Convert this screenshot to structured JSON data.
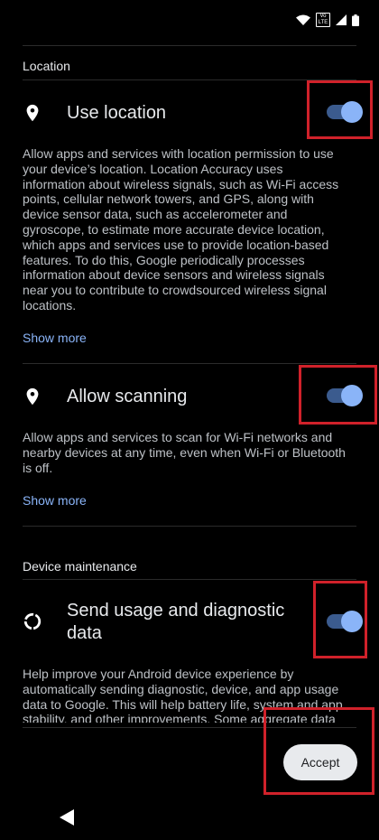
{
  "status_bar": {
    "lte_text": "Vo LTE"
  },
  "location_section": {
    "header": "Location",
    "use_location": {
      "title": "Use location",
      "enabled": true,
      "description": "Allow apps and services with location permission to use your device’s location. Location Accuracy uses information about wireless signals, such as Wi-Fi access points, cellular network towers, and GPS, along with device sensor data, such as accelerometer and gyroscope, to estimate more accurate device location, which apps and services use to provide location-based features. To do this, Google periodically processes information about device sensors and wireless signals near you to contribute to crowdsourced wireless signal locations.",
      "show_more": "Show more"
    },
    "allow_scanning": {
      "title": "Allow scanning",
      "enabled": true,
      "description": "Allow apps and services to scan for Wi-Fi networks and nearby devices at any time, even when Wi-Fi or Bluetooth is off.",
      "show_more": "Show more"
    }
  },
  "maintenance_section": {
    "header": "Device maintenance",
    "send_usage": {
      "title_line1": "Send usage and diagnostic",
      "title_line2": "data",
      "enabled": true,
      "description": "Help improve your Android device experience by automatically sending diagnostic, device, and app usage data to Google. This will help battery life, system and app stability, and other improvements. Some aggregate data will also help Google apps and partners, such as Android"
    }
  },
  "footer": {
    "accept_label": "Accept"
  },
  "colors": {
    "accent": "#8ab4f8",
    "highlight": "#d0212a",
    "background": "#000000"
  }
}
